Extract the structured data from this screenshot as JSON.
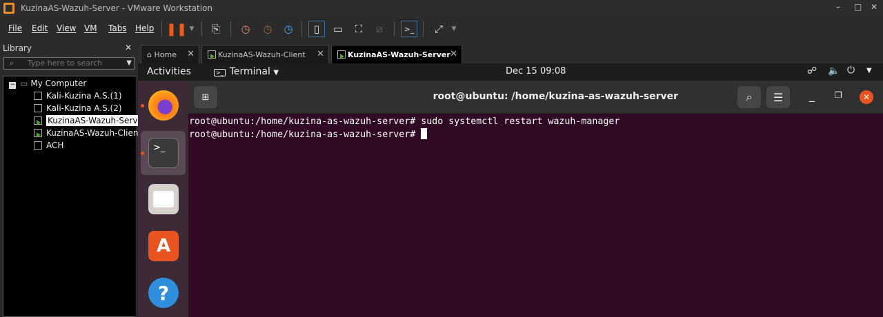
{
  "window": {
    "title": "KuzinaAS-Wazuh-Server - VMware Workstation",
    "min": "–",
    "max": "□",
    "close": "✕"
  },
  "menu": [
    "File",
    "Edit",
    "View",
    "VM",
    "Tabs",
    "Help"
  ],
  "library": {
    "title": "Library",
    "close": "✕",
    "search_placeholder": "Type here to search",
    "root": "My Computer",
    "vms": [
      "Kali-Kuzina A.S.(1)",
      "Kali-Kuzina A.S.(2)",
      "KuzinaAS-Wazuh-Server",
      "KuzinaAS-Wazuh-Client",
      "ACH"
    ]
  },
  "tabs": [
    {
      "label": "Home"
    },
    {
      "label": "KuzinaAS-Wazuh-Client"
    },
    {
      "label": "KuzinaAS-Wazuh-Server",
      "active": true
    }
  ],
  "gnome": {
    "activities": "Activities",
    "app": "Terminal",
    "clock": "Dec 15  09:08"
  },
  "terminal": {
    "title": "root@ubuntu: /home/kuzina-as-wazuh-server",
    "lines": [
      "root@ubuntu:/home/kuzina-as-wazuh-server# sudo systemctl restart wazuh-manager",
      "root@ubuntu:/home/kuzina-as-wazuh-server# "
    ]
  },
  "colors": {
    "terminal_bg": "#300a24",
    "ubuntu_orange": "#e95420",
    "vmware_orange": "#f08a24"
  }
}
